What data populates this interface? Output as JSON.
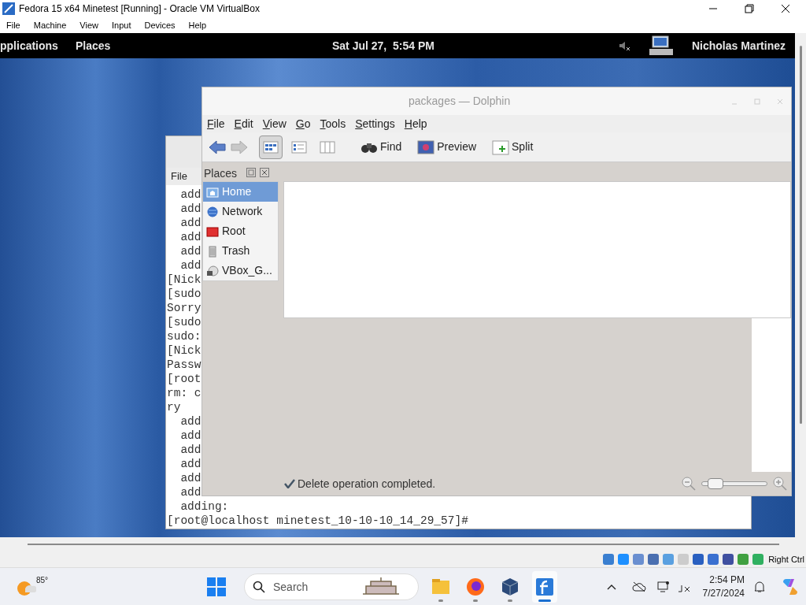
{
  "vbox": {
    "title": "Fedora 15 x64 Minetest [Running] - Oracle VM VirtualBox",
    "menu": [
      "File",
      "Machine",
      "View",
      "Input",
      "Devices",
      "Help"
    ]
  },
  "gnome_panel": {
    "menus": [
      "pplications",
      "Places"
    ],
    "clock": "Sat Jul 27,  5:54 PM",
    "user": "Nicholas Martinez"
  },
  "terminal": {
    "menu": [
      "File"
    ],
    "lines": [
      "  add",
      "  add",
      "  add",
      "  add",
      "  add",
      "  add",
      "[Nick",
      "[sudo",
      "Sorry",
      "[sudo",
      "sudo:",
      "[Nick",
      "Passw",
      "[root",
      "rm: c",
      "ry",
      "  add",
      "  add",
      "  add",
      "  add",
      "  add",
      "  add",
      "  adding:",
      "[root@localhost minetest_10-10-10_14_29_57]#"
    ]
  },
  "dolphin": {
    "title": "packages — Dolphin",
    "menu": [
      "File",
      "Edit",
      "View",
      "Go",
      "Tools",
      "Settings",
      "Help"
    ],
    "view_modes": [
      {
        "kind": "icons",
        "selected": true
      },
      {
        "kind": "details",
        "selected": false
      },
      {
        "kind": "columns",
        "selected": false
      }
    ],
    "actions": [
      {
        "kind": "find",
        "label": "Find"
      },
      {
        "kind": "preview",
        "label": "Preview"
      },
      {
        "kind": "split",
        "label": "Split"
      }
    ],
    "places_title": "Places",
    "places": [
      {
        "kind": "home",
        "label": "Home",
        "selected": true
      },
      {
        "kind": "network",
        "label": "Network",
        "selected": false
      },
      {
        "kind": "root",
        "label": "Root",
        "selected": false
      },
      {
        "kind": "trash",
        "label": "Trash",
        "selected": false
      },
      {
        "kind": "drive",
        "label": "VBox_G...",
        "selected": false
      }
    ],
    "status": "Delete operation completed.",
    "zoom": {
      "level": 0.2
    }
  },
  "vbox_status": {
    "host_key": "Right Ctrl"
  },
  "taskbar": {
    "weather": "85°",
    "search_placeholder": "Search",
    "apps": [
      {
        "kind": "folder",
        "active": false
      },
      {
        "kind": "firefox",
        "active": false
      },
      {
        "kind": "virtualbox",
        "active": false
      },
      {
        "kind": "fedora",
        "active": true
      }
    ],
    "time": "2:54 PM",
    "date": "7/27/2024"
  }
}
